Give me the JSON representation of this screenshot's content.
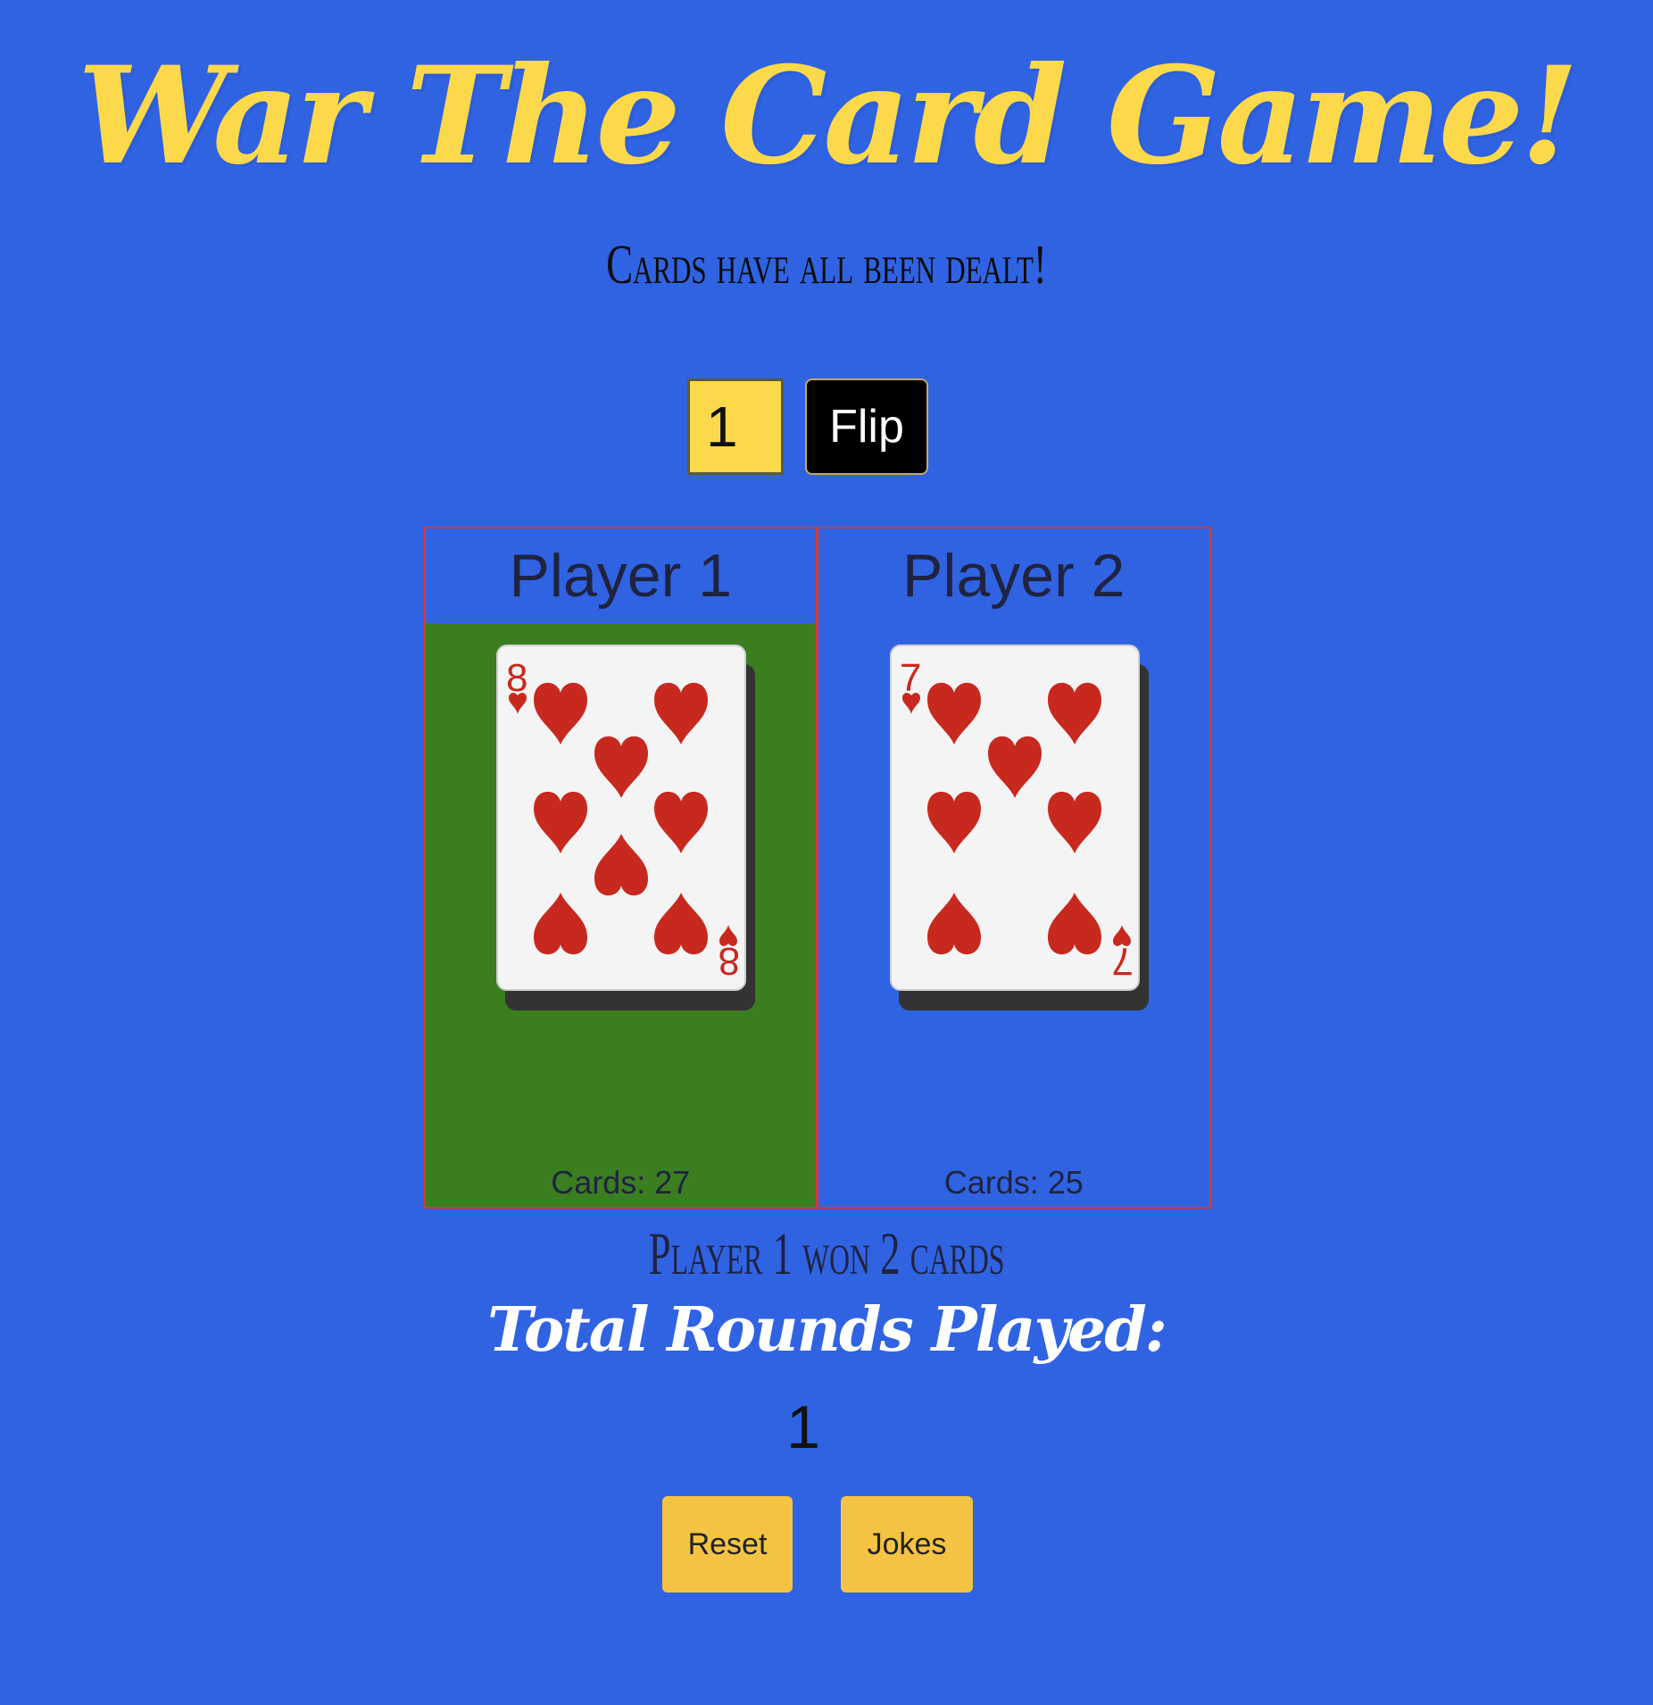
{
  "header": {
    "title": "War The Card Game!",
    "status": "Cards have all been dealt!"
  },
  "controls": {
    "flip_count_value": "1",
    "flip_label": "Flip"
  },
  "players": [
    {
      "name": "Player 1",
      "card": {
        "rank": "8",
        "suit": "hearts",
        "suit_icon": "heart-icon"
      },
      "cards_label": "Cards: 27",
      "is_round_winner": true
    },
    {
      "name": "Player 2",
      "card": {
        "rank": "7",
        "suit": "hearts",
        "suit_icon": "heart-icon"
      },
      "cards_label": "Cards: 25",
      "is_round_winner": false
    }
  ],
  "round": {
    "result": "Player 1 won 2 cards",
    "total_label": "Total Rounds Played:",
    "total_value": "1"
  },
  "buttons": {
    "reset_label": "Reset",
    "jokes_label": "Jokes"
  },
  "colors": {
    "background": "#3063e2",
    "title": "#fbd94b",
    "winner": "#3a7e20",
    "suit_red": "#c8291f",
    "button_yellow": "#f4c343"
  }
}
